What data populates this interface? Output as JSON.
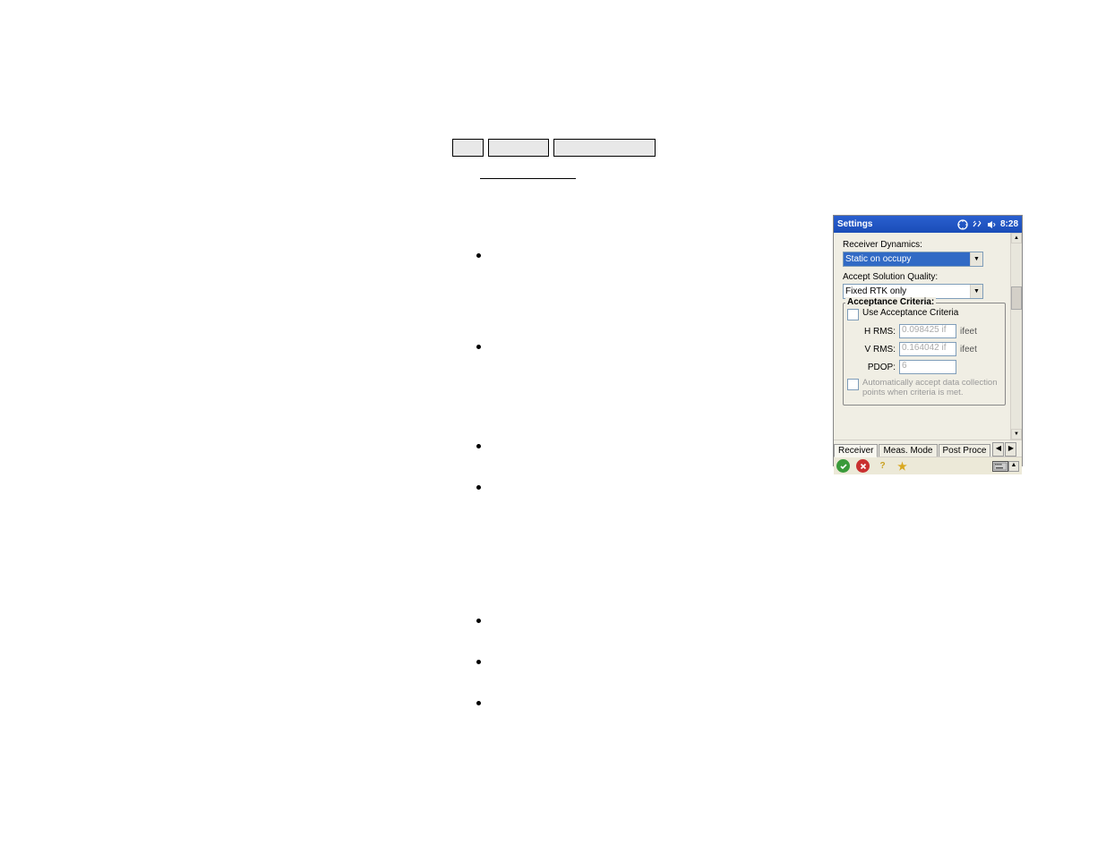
{
  "titlebar": {
    "title": "Settings",
    "time": "8:28"
  },
  "receiverDynamics": {
    "label": "Receiver Dynamics:",
    "value": "Static on occupy"
  },
  "acceptSolution": {
    "label": "Accept Solution Quality:",
    "value": "Fixed RTK only"
  },
  "acceptanceCriteria": {
    "legend": "Acceptance Criteria:",
    "useLabel": "Use Acceptance Criteria",
    "hrms": {
      "label": "H RMS:",
      "value": "0.098425 if",
      "unit": "ifeet"
    },
    "vrms": {
      "label": "V RMS:",
      "value": "0.164042 if",
      "unit": "ifeet"
    },
    "pdop": {
      "label": "PDOP:",
      "value": "6"
    },
    "autoAcceptLabel": "Automatically accept data collection points when criteria is met."
  },
  "tabs": {
    "receiver": "Receiver",
    "measMode": "Meas. Mode",
    "postProc": "Post Proce"
  }
}
